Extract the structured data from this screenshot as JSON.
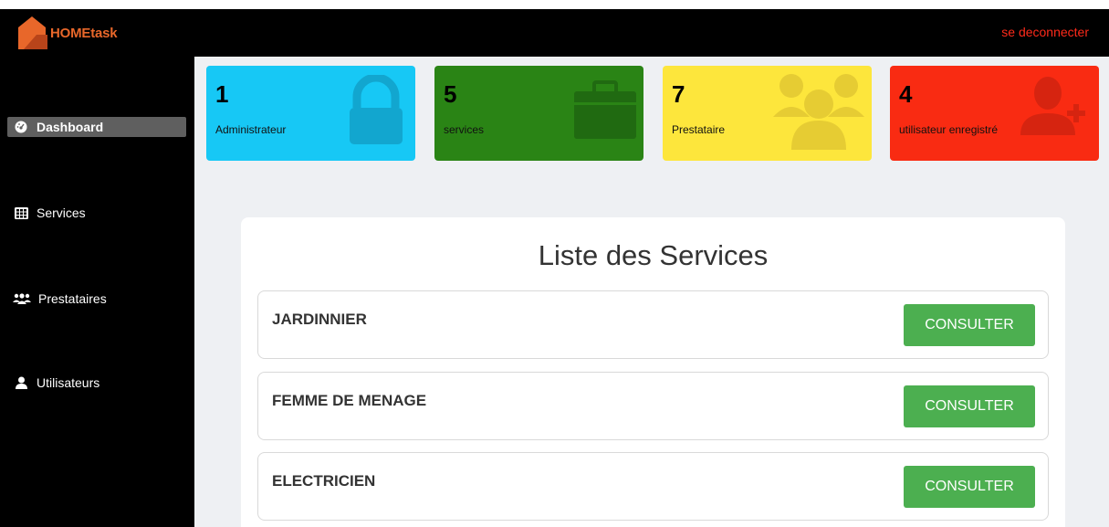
{
  "app": {
    "logo_text": "HOMEtask",
    "logout_label": "se deconnecter"
  },
  "sidebar": {
    "items": [
      {
        "label": "Dashboard",
        "icon": "dashboard-gauge-icon",
        "active": true
      },
      {
        "label": "Services",
        "icon": "grid-table-icon",
        "active": false
      },
      {
        "label": "Prestataires",
        "icon": "users-group-icon",
        "active": false
      },
      {
        "label": "Utilisateurs",
        "icon": "user-icon",
        "active": false
      }
    ]
  },
  "stats": [
    {
      "value": "1",
      "label": "Administrateur",
      "color": "#17c8f5",
      "icon": "lock-icon"
    },
    {
      "value": "5",
      "label": "services",
      "color": "#2a8415",
      "icon": "toolbox-icon"
    },
    {
      "value": "7",
      "label": "Prestataire",
      "color": "#fde63c",
      "icon": "users-group-icon"
    },
    {
      "value": "4",
      "label": "utilisateur enregistré",
      "color": "#f92b12",
      "icon": "user-plus-icon"
    }
  ],
  "services_panel": {
    "title": "Liste des Services",
    "button_label": "CONSULTER",
    "services": [
      {
        "name": "JARDINNIER"
      },
      {
        "name": "FEMME DE MENAGE"
      },
      {
        "name": "ELECTRICIEN"
      }
    ]
  },
  "colors": {
    "topbar": "#000000",
    "sidebar": "#000000",
    "accent_logout": "#ff2a1a",
    "consult_button": "#4caf50",
    "main_bg": "#eef0f3"
  }
}
